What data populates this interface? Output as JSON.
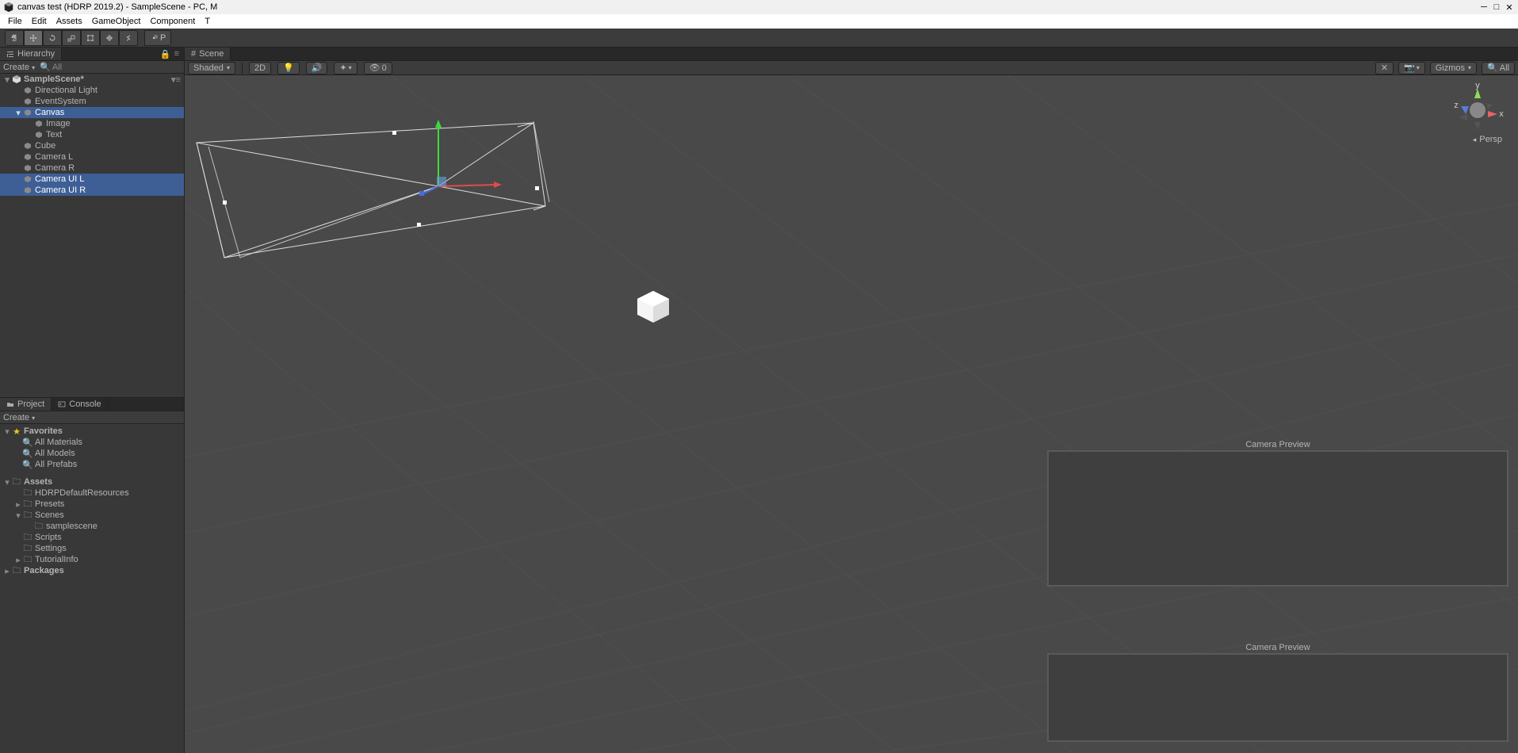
{
  "window": {
    "title": "canvas test (HDRP 2019.2) - SampleScene - PC, M"
  },
  "menu": {
    "items": [
      "File",
      "Edit",
      "Assets",
      "GameObject",
      "Component",
      "T"
    ]
  },
  "toolbar": {
    "pivot": "P"
  },
  "hierarchy": {
    "tab_label": "Hierarchy",
    "create": "Create",
    "search_all": "All",
    "scene_name": "SampleScene*",
    "items": [
      {
        "label": "Directional Light",
        "indent": 1,
        "selected": false,
        "expandable": false
      },
      {
        "label": "EventSystem",
        "indent": 1,
        "selected": false,
        "expandable": false
      },
      {
        "label": "Canvas",
        "indent": 1,
        "selected": true,
        "expandable": true,
        "expanded": true
      },
      {
        "label": "Image",
        "indent": 2,
        "selected": false,
        "expandable": false
      },
      {
        "label": "Text",
        "indent": 2,
        "selected": false,
        "expandable": false
      },
      {
        "label": "Cube",
        "indent": 1,
        "selected": false,
        "expandable": false
      },
      {
        "label": "Camera L",
        "indent": 1,
        "selected": false,
        "expandable": false
      },
      {
        "label": "Camera R",
        "indent": 1,
        "selected": false,
        "expandable": false
      },
      {
        "label": "Camera UI L",
        "indent": 1,
        "selected": true,
        "expandable": false
      },
      {
        "label": "Camera UI R",
        "indent": 1,
        "selected": true,
        "expandable": false
      }
    ]
  },
  "project": {
    "tab_label": "Project",
    "console_label": "Console",
    "create": "Create",
    "favorites_label": "Favorites",
    "favorites": [
      "All Materials",
      "All Models",
      "All Prefabs"
    ],
    "assets_label": "Assets",
    "assets": [
      {
        "label": "HDRPDefaultResources",
        "expandable": false
      },
      {
        "label": "Presets",
        "expandable": true
      },
      {
        "label": "Scenes",
        "expandable": true,
        "expanded": true,
        "children": [
          {
            "label": "samplescene"
          }
        ]
      },
      {
        "label": "Scripts",
        "expandable": false
      },
      {
        "label": "Settings",
        "expandable": false
      },
      {
        "label": "TutorialInfo",
        "expandable": true
      }
    ],
    "packages_label": "Packages"
  },
  "scene": {
    "tab_label": "Scene",
    "shading_mode": "Shaded",
    "mode_2d": "2D",
    "gizmos_count": "0",
    "gizmos_label": "Gizmos",
    "all_label": "All",
    "persp_label": "Persp",
    "camera_preview_label": "Camera Preview",
    "axes": {
      "x": "x",
      "y": "y",
      "z": "z"
    }
  }
}
